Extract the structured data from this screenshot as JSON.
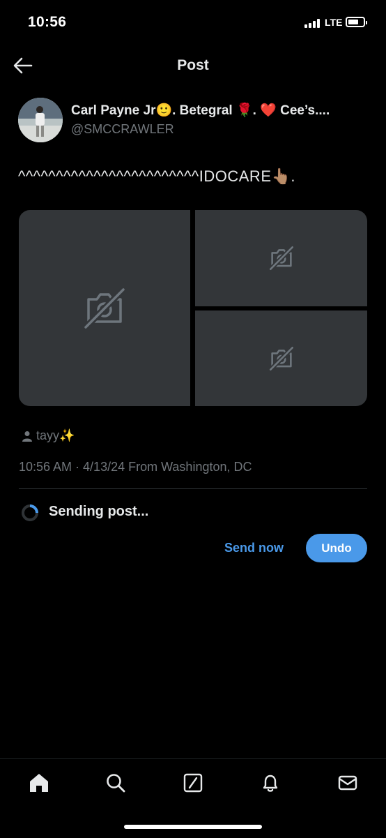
{
  "status_bar": {
    "time": "10:56",
    "network": "LTE"
  },
  "header": {
    "title": "Post",
    "back_icon": "arrow-left-icon"
  },
  "post": {
    "display_name": "Carl Payne Jr🙂. Betegral 🌹. ❤️ Cee’s....",
    "handle": "@SMCCRAWLER",
    "text": "^^^^^^^^^^^^^^^^^^^^^^^^IDOCARE👆🏽.",
    "media_placeholder_icon": "image-unavailable-icon",
    "tagged_user": "tayy✨",
    "meta": "10:56 AM · 4/13/24 From Washington, DC"
  },
  "sending": {
    "label": "Sending post...",
    "send_now_label": "Send now",
    "undo_label": "Undo"
  },
  "tabbar": {
    "items": [
      {
        "name": "home",
        "icon": "home-icon"
      },
      {
        "name": "search",
        "icon": "search-icon"
      },
      {
        "name": "grok",
        "icon": "grok-icon"
      },
      {
        "name": "notifications",
        "icon": "bell-icon"
      },
      {
        "name": "messages",
        "icon": "mail-icon"
      }
    ]
  },
  "colors": {
    "background": "#000000",
    "accent": "#4a99e9",
    "muted": "#71767b",
    "tile": "#333639"
  }
}
